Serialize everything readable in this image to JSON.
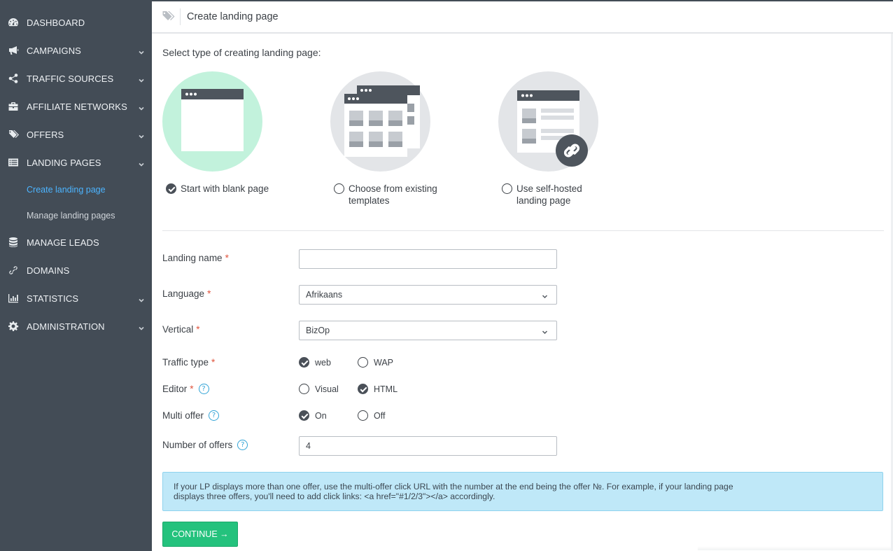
{
  "sidebar": {
    "items": [
      {
        "label": "DASHBOARD",
        "icon": "dashboard-icon",
        "has_chevron": false
      },
      {
        "label": "CAMPAIGNS",
        "icon": "megaphone-icon",
        "has_chevron": true
      },
      {
        "label": "TRAFFIC SOURCES",
        "icon": "share-icon",
        "has_chevron": true
      },
      {
        "label": "AFFILIATE NETWORKS",
        "icon": "briefcase-icon",
        "has_chevron": true
      },
      {
        "label": "OFFERS",
        "icon": "tags-icon",
        "has_chevron": true
      },
      {
        "label": "LANDING PAGES",
        "icon": "list-alt-icon",
        "has_chevron": true
      },
      {
        "label": "MANAGE LEADS",
        "icon": "database-icon",
        "has_chevron": false
      },
      {
        "label": "DOMAINS",
        "icon": "link-icon",
        "has_chevron": false
      },
      {
        "label": "STATISTICS",
        "icon": "bar-chart-icon",
        "has_chevron": true
      },
      {
        "label": "ADMINISTRATION",
        "icon": "gear-icon",
        "has_chevron": true
      }
    ],
    "subitems": [
      {
        "label": "Create landing page",
        "active": true
      },
      {
        "label": "Manage landing pages",
        "active": false
      }
    ]
  },
  "header": {
    "title": "Create landing page",
    "icon": "tags-icon"
  },
  "main": {
    "section_label": "Select type of creating landing page:",
    "options": [
      {
        "line1": "Start with blank page",
        "line2": "",
        "checked": true,
        "illustration": "blank-page"
      },
      {
        "line1": "Choose from existing",
        "line2": "templates",
        "checked": false,
        "illustration": "templates"
      },
      {
        "line1": "Use self-hosted",
        "line2": "landing page",
        "checked": false,
        "illustration": "self-hosted-link"
      }
    ]
  },
  "form": {
    "landing_name": {
      "label": "Landing name",
      "value": "",
      "required": true
    },
    "language": {
      "label": "Language",
      "value": "Afrikaans",
      "required": true
    },
    "vertical": {
      "label": "Vertical",
      "value": "BizOp",
      "required": true
    },
    "traffic_type": {
      "label": "Traffic type",
      "required": true,
      "options": [
        {
          "label": "web",
          "checked": true
        },
        {
          "label": "WAP",
          "checked": false
        }
      ]
    },
    "editor": {
      "label": "Editor",
      "required": true,
      "options": [
        {
          "label": "Visual",
          "checked": false
        },
        {
          "label": "HTML",
          "checked": true
        }
      ]
    },
    "multi_offer": {
      "label": "Multi offer",
      "options": [
        {
          "label": "On",
          "checked": true
        },
        {
          "label": "Off",
          "checked": false
        }
      ]
    },
    "number_of_offers": {
      "label": "Number of offers",
      "value": "4"
    },
    "required_mark": "*",
    "help_mark": "?"
  },
  "notice": "If your LP displays more than one offer, use the multi-offer click URL with the number at the end being the offer №. For example, if your landing page displays three offers, you'll need to add click links: <a href=\"#1/2/3\"></a> accordingly.",
  "continue_label": "CONTINUE →",
  "colors": {
    "sidebar_bg": "#434c56",
    "active_link": "#4cb4ff",
    "continue_bg": "#24c27d",
    "notice_bg": "#bfe8f8",
    "required": "#e0533c",
    "help": "#31a3d6"
  }
}
